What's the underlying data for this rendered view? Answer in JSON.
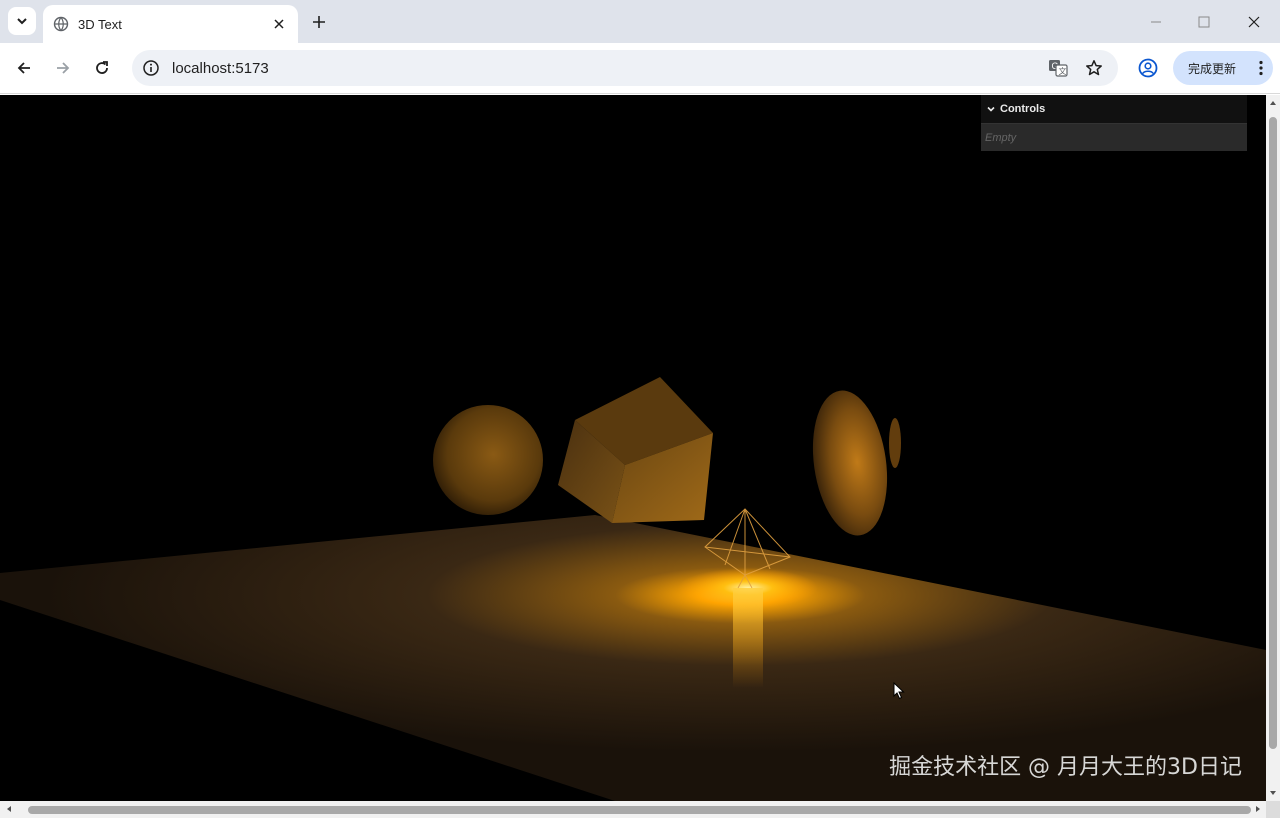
{
  "browser": {
    "tab_title": "3D Text",
    "url": "localhost:5173",
    "update_button_label": "完成更新"
  },
  "gui": {
    "title": "Controls",
    "empty_label": "Empty"
  },
  "watermark": "掘金技术社区 @ 月月大王的3D日记",
  "colors": {
    "accent_light": "#ffb000",
    "scene_background": "#000000",
    "floor": "#2a1e12"
  }
}
